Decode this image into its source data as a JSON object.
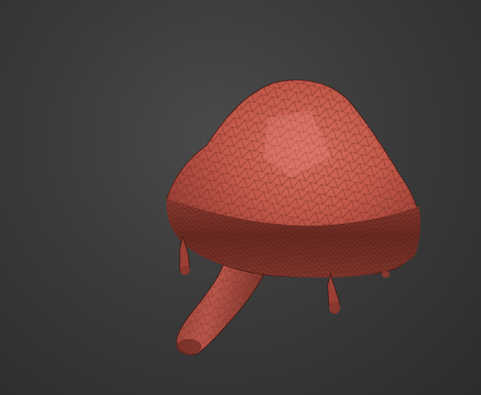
{
  "viewport": {
    "background_color": "#3a3a3a",
    "shading": "wireframe-on-shaded",
    "mesh_color": "#c2574a",
    "wire_color": "#6e2a22"
  },
  "model": {
    "parts": [
      "cap",
      "stem",
      "drip-left",
      "drip-right"
    ]
  }
}
